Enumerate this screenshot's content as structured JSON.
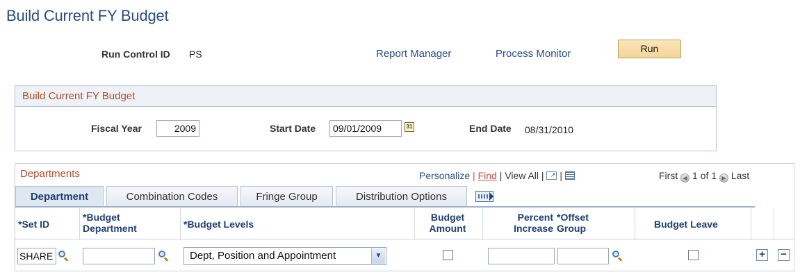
{
  "page": {
    "title": "Build Current FY Budget"
  },
  "header": {
    "run_control_label": "Run Control ID",
    "run_control_value": "PS",
    "report_manager": "Report Manager",
    "process_monitor": "Process Monitor",
    "run_button": "Run"
  },
  "group": {
    "title": "Build Current FY Budget",
    "fiscal_year_label": "Fiscal Year",
    "fiscal_year_value": "2009",
    "start_date_label": "Start Date",
    "start_date_value": "09/01/2009",
    "calendar_icon_text": "31",
    "end_date_label": "End Date",
    "end_date_value": "08/31/2010"
  },
  "grid": {
    "title": "Departments",
    "toolbar": {
      "personalize": "Personalize",
      "sep1": "|",
      "find": "Find",
      "sep2": "|",
      "view_all": "View All",
      "sep3": "|",
      "sep4": "|",
      "first": "First",
      "range": "1 of 1",
      "last": "Last"
    },
    "tabs": [
      {
        "label": "Department"
      },
      {
        "label": "Combination Codes"
      },
      {
        "label": "Fringe Group"
      },
      {
        "label": "Distribution Options"
      }
    ],
    "columns": {
      "set_id": "*Set ID",
      "budget_department_1": "*Budget",
      "budget_department_2": "Department",
      "budget_levels": "*Budget Levels",
      "budget_amount_1": "Budget",
      "budget_amount_2": "Amount",
      "percent_increase_1": "Percent",
      "percent_increase_2": "Increase",
      "offset_group_1": "*Offset",
      "offset_group_2": "Group",
      "budget_leave": "Budget Leave"
    },
    "row": {
      "set_id": "SHARE",
      "budget_department": "",
      "budget_levels": "Dept, Position and Appointment",
      "budget_amount_checked": false,
      "percent_increase": "",
      "offset_group": "",
      "budget_leave_checked": false,
      "add_row": "+",
      "delete_row": "−"
    }
  }
}
